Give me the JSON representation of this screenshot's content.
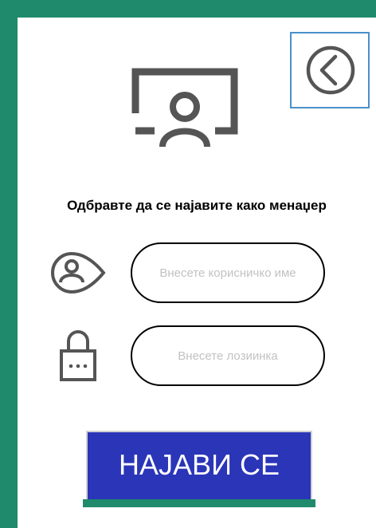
{
  "login": {
    "prompt": "Одбравте да се најавите како менаџер",
    "username_placeholder": "Внесете корисничко име",
    "password_placeholder": "Внесете лозиинка",
    "login_label": "НАЈАВИ СЕ"
  },
  "icons": {
    "back": "back-arrow-circle-icon",
    "hero": "presenter-screen-icon",
    "user": "user-location-icon",
    "lock": "lock-icon"
  },
  "colors": {
    "frame": "#1f8a6c",
    "button": "#2b35b8",
    "back_border": "#4a90c8",
    "icon": "#555555"
  }
}
